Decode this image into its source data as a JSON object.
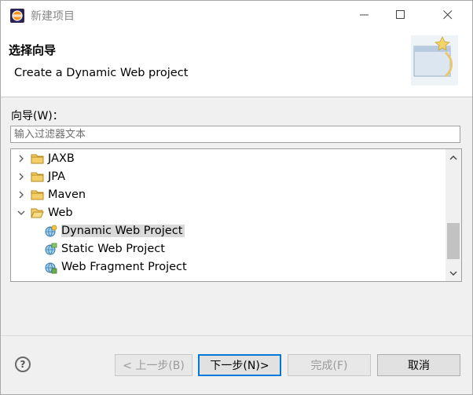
{
  "window": {
    "title": "新建项目"
  },
  "header": {
    "title": "选择向导",
    "description": "Create a Dynamic Web project"
  },
  "filter": {
    "label": "向导(W)：",
    "placeholder": "输入过滤器文本"
  },
  "tree": {
    "folders": [
      {
        "label": "JAXB",
        "expanded": false
      },
      {
        "label": "JPA",
        "expanded": false
      },
      {
        "label": "Maven",
        "expanded": false
      },
      {
        "label": "Web",
        "expanded": true
      }
    ],
    "web_children": [
      {
        "label": "Dynamic Web Project",
        "selected": true
      },
      {
        "label": "Static Web Project",
        "selected": false
      },
      {
        "label": "Web Fragment Project",
        "selected": false
      }
    ]
  },
  "buttons": {
    "back": "< 上一步(B)",
    "next": "下一步(N)>",
    "finish": "完成(F)",
    "cancel": "取消"
  },
  "colors": {
    "accent": "#0078d7",
    "folder": "#e8b84a",
    "selection": "#d9d9d9"
  }
}
